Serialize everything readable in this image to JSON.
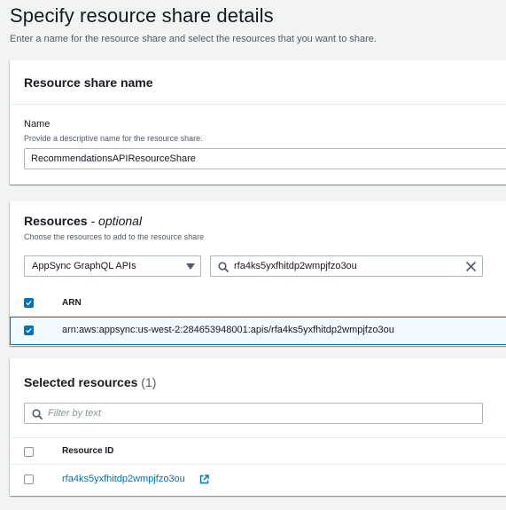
{
  "page": {
    "title": "Specify resource share details",
    "subtitle": "Enter a name for the resource share and select the resources that you want to share."
  },
  "name_panel": {
    "header": "Resource share name",
    "field_label": "Name",
    "field_description": "Provide a descriptive name for the resource share.",
    "field_value": "RecommendationsAPIResourceShare"
  },
  "resources_panel": {
    "header": "Resources",
    "header_suffix": "- optional",
    "description": "Choose the resources to add to the resource share",
    "resource_type_selected": "AppSync GraphQL APIs",
    "search_value": "rfa4ks5yxfhitdp2wmpjfzo3ou",
    "table": {
      "columns": [
        "ARN"
      ],
      "rows": [
        {
          "arn": "arn:aws:appsync:us-west-2:284653948001:apis/rfa4ks5yxfhitdp2wmpjfzo3ou",
          "checked": true
        }
      ],
      "header_checked": true
    }
  },
  "selected_panel": {
    "header": "Selected resources",
    "count": "(1)",
    "filter_placeholder": "Filter by text",
    "table": {
      "columns": [
        "Resource ID"
      ],
      "rows": [
        {
          "resource_id": "rfa4ks5yxfhitdp2wmpjfzo3ou",
          "checked": false
        }
      ]
    }
  },
  "colors": {
    "accent": "#0073bb",
    "background": "#f2f3f3",
    "selected_row": "#f1faff"
  },
  "icons": [
    "dropdown-arrow-icon",
    "search-icon",
    "clear-icon",
    "checkbox-checked-icon",
    "checkbox-empty-icon",
    "external-link-icon"
  ]
}
